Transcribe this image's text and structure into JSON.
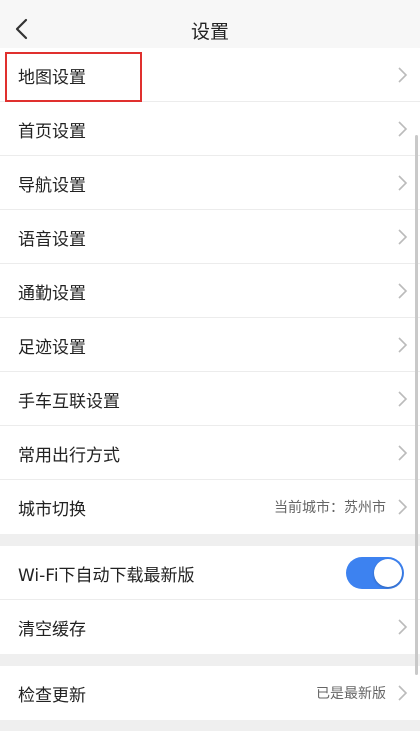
{
  "header": {
    "title": "设置",
    "back_icon": "back-arrow-icon"
  },
  "group1": [
    {
      "id": "map",
      "label": "地图设置"
    },
    {
      "id": "home",
      "label": "首页设置"
    },
    {
      "id": "navigation",
      "label": "导航设置"
    },
    {
      "id": "voice",
      "label": "语音设置"
    },
    {
      "id": "commute",
      "label": "通勤设置"
    },
    {
      "id": "footprint",
      "label": "足迹设置"
    },
    {
      "id": "phone-car",
      "label": "手车互联设置"
    },
    {
      "id": "travel-mode",
      "label": "常用出行方式"
    },
    {
      "id": "city",
      "label": "城市切换",
      "value": "当前城市：苏州市"
    }
  ],
  "group2": [
    {
      "id": "wifi-download",
      "label": "Wi-Fi下自动下载最新版",
      "toggle_on": true
    },
    {
      "id": "clear-cache",
      "label": "清空缓存"
    }
  ],
  "group3": [
    {
      "id": "check-update",
      "label": "检查更新",
      "value": "已是最新版"
    }
  ],
  "colors": {
    "accent": "#3d82f0",
    "highlight": "#e0302e"
  }
}
